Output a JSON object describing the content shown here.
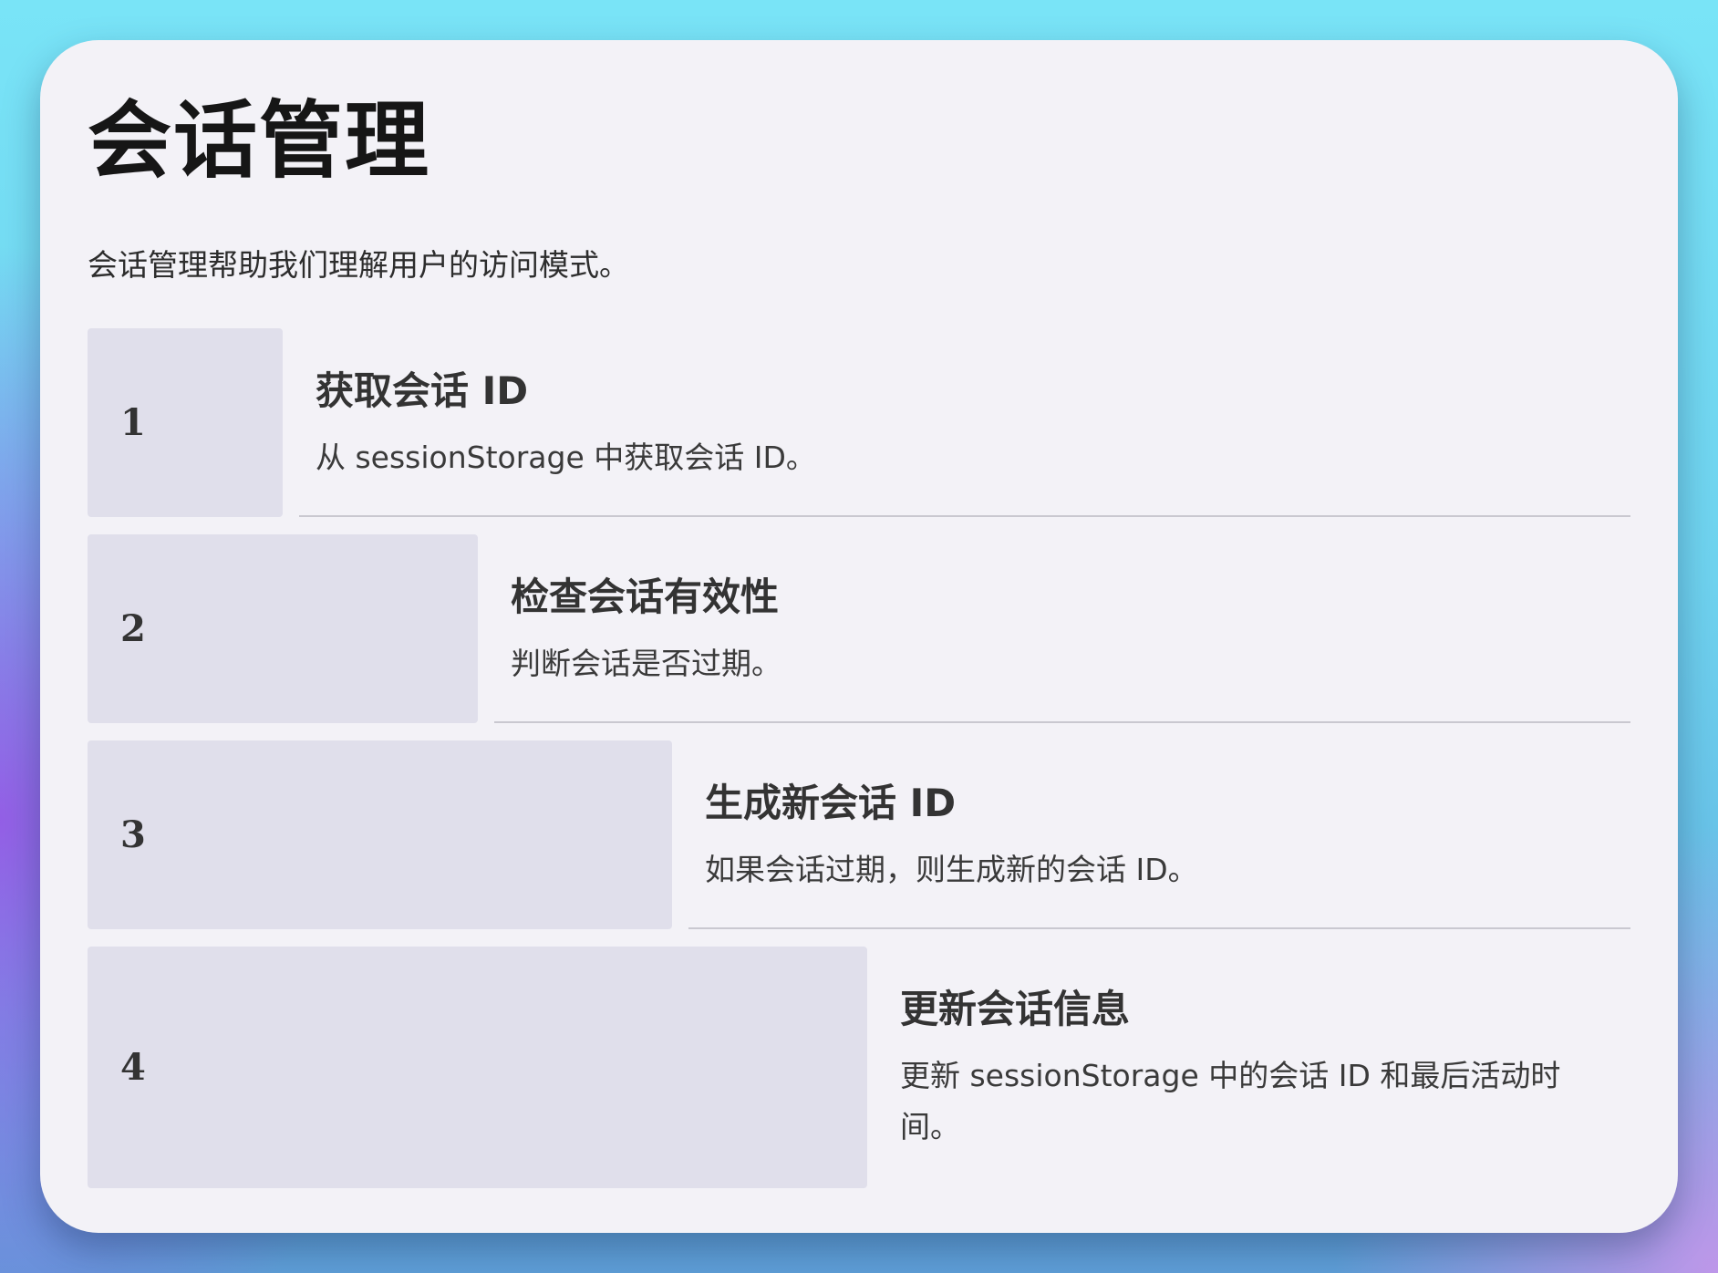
{
  "title": "会话管理",
  "intro": "会话管理帮助我们理解用户的访问模式。",
  "steps": [
    {
      "number": "1",
      "title": "获取会话 ID",
      "description": "从 sessionStorage 中获取会话 ID。"
    },
    {
      "number": "2",
      "title": "检查会话有效性",
      "description": "判断会话是否过期。"
    },
    {
      "number": "3",
      "title": "生成新会话 ID",
      "description": "如果会话过期，则生成新的会话 ID。"
    },
    {
      "number": "4",
      "title": "更新会话信息",
      "description": "更新 sessionStorage 中的会话 ID 和最后活动时间。"
    }
  ]
}
